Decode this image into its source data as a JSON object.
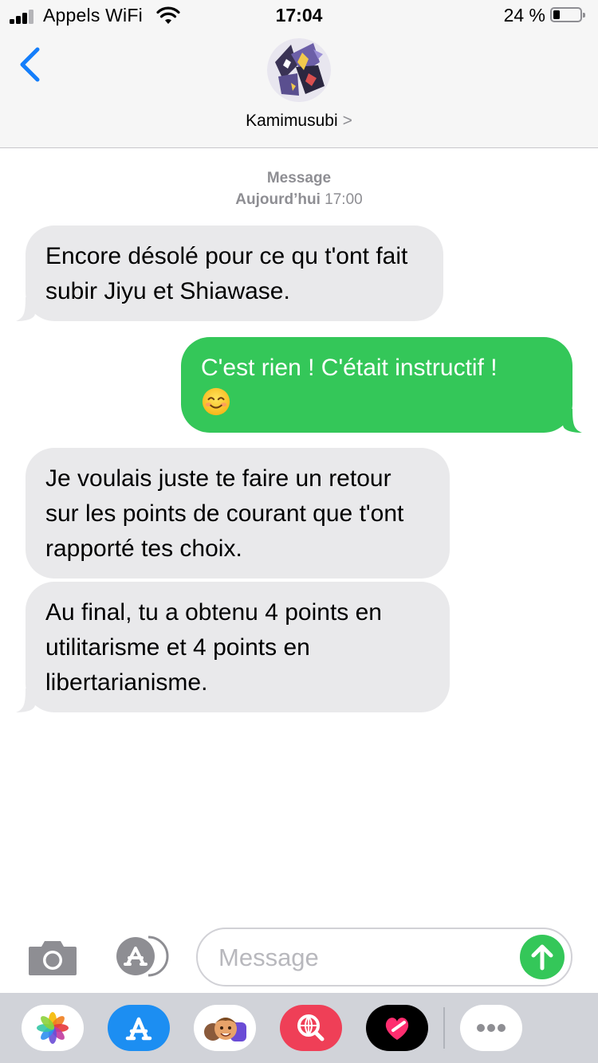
{
  "status_bar": {
    "carrier": "Appels WiFi",
    "time": "17:04",
    "battery_percent": "24 %",
    "battery_level": 0.24,
    "signal_bars": 3
  },
  "header": {
    "contact_name": "Kamimusubi",
    "contact_chevron": ">"
  },
  "conversation": {
    "service_label": "Message",
    "timestamp_day": "Aujourd’hui",
    "timestamp_time": "17:00",
    "messages": [
      {
        "direction": "received",
        "text": "Encore désolé pour ce qu t'ont fait subir Jiyu et Shiawase."
      },
      {
        "direction": "sent",
        "text": "C'est rien ! C'était instructif !",
        "emoji": "smiling-face-icon"
      },
      {
        "direction": "received",
        "text": "Je voulais juste te faire un retour sur les points de courant que t'ont rapporté tes choix."
      },
      {
        "direction": "received",
        "text": "Au final, tu a obtenu 4 points en utilitarisme et 4 points en libertarianisme."
      }
    ]
  },
  "composer": {
    "placeholder": "Message",
    "value": ""
  },
  "app_drawer": {
    "apps": [
      "photos-app-icon",
      "app-store-app-icon",
      "memoji-app-icon",
      "web-search-app-icon",
      "digital-touch-app-icon",
      "more-apps-icon"
    ]
  },
  "colors": {
    "sent_bubble": "#34c759",
    "received_bubble": "#e9e9eb",
    "accent_blue": "#147efb",
    "header_bg": "#f6f6f6",
    "drawer_bg": "#d1d3d9"
  }
}
